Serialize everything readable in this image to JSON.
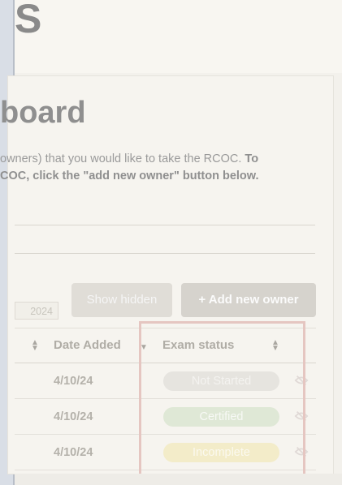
{
  "header": {
    "logo_text": "S"
  },
  "page": {
    "title": "board",
    "intro_line1_normal": "owners) that you would like to take the RCOC. ",
    "intro_line1_bold": "To",
    "intro_line2_bold": "COC, click the \"add new owner\" button below."
  },
  "filters": {
    "year_value": "2024"
  },
  "buttons": {
    "show_hidden": "Show hidden",
    "add_owner": "+ Add new owner"
  },
  "table": {
    "columns": {
      "date_added": "Date Added",
      "exam_status": "Exam status"
    },
    "rows": [
      {
        "date_added": "4/10/24",
        "exam_status": "Not Started"
      },
      {
        "date_added": "4/10/24",
        "exam_status": "Certified"
      },
      {
        "date_added": "4/10/24",
        "exam_status": "Incomplete"
      }
    ]
  },
  "colors": {
    "not_started_bg": "#e6e4df",
    "certified_bg": "#dfe8d6",
    "incomplete_bg": "#f3ecc9",
    "highlight_border": "#e5c6c1"
  },
  "icons": {
    "row_action": "eye-slash-icon",
    "sort": "sort-arrows-icon"
  }
}
